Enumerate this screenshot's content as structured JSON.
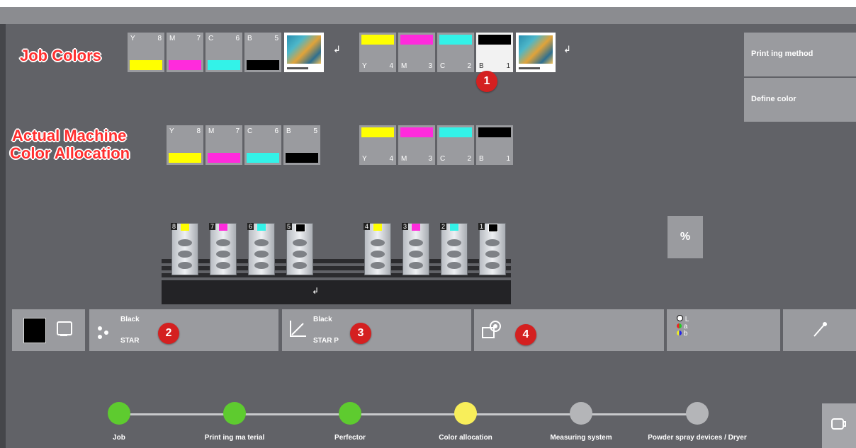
{
  "labels": {
    "job_colors": "Job Colors",
    "actual_machine_1": "Actual Machine",
    "actual_machine_2": "Color Allocation"
  },
  "job_row_left": [
    {
      "letter": "Y",
      "num": "8",
      "color": "#ffff00"
    },
    {
      "letter": "M",
      "num": "7",
      "color": "#ff2bdc"
    },
    {
      "letter": "C",
      "num": "6",
      "color": "#33f2e8"
    },
    {
      "letter": "B",
      "num": "5",
      "color": "#000000"
    }
  ],
  "job_row_right": [
    {
      "letter": "Y",
      "num": "4",
      "color": "#ffff00"
    },
    {
      "letter": "M",
      "num": "3",
      "color": "#ff2bdc"
    },
    {
      "letter": "C",
      "num": "2",
      "color": "#33f2e8"
    },
    {
      "letter": "B",
      "num": "1",
      "color": "#000000"
    }
  ],
  "machine_row_left": [
    {
      "letter": "Y",
      "num": "8",
      "color": "#ffff00"
    },
    {
      "letter": "M",
      "num": "7",
      "color": "#ff2bdc"
    },
    {
      "letter": "C",
      "num": "6",
      "color": "#33f2e8"
    },
    {
      "letter": "B",
      "num": "5",
      "color": "#000000"
    }
  ],
  "machine_row_right": [
    {
      "letter": "Y",
      "num": "4",
      "color": "#ffff00"
    },
    {
      "letter": "M",
      "num": "3",
      "color": "#ff2bdc"
    },
    {
      "letter": "C",
      "num": "2",
      "color": "#33f2e8"
    },
    {
      "letter": "B",
      "num": "1",
      "color": "#000000"
    }
  ],
  "badges": {
    "b1": "1",
    "b2": "2",
    "b3": "3",
    "b4": "4"
  },
  "side_buttons": {
    "printing_method": "Print ing method",
    "define_color": "Define color"
  },
  "toolbar": {
    "star_top": "Black",
    "star_bottom": "STAR",
    "starp_top": "Black",
    "starp_bottom": "STAR P",
    "lab_l": "L",
    "lab_a": "a",
    "lab_b": "b"
  },
  "units": [
    {
      "num": "8",
      "color": "#ffff00"
    },
    {
      "num": "7",
      "color": "#ff2bdc"
    },
    {
      "num": "6",
      "color": "#33f2e8"
    },
    {
      "num": "5",
      "color": "#000000"
    },
    {
      "num": "4",
      "color": "#ffff00"
    },
    {
      "num": "3",
      "color": "#ff2bdc"
    },
    {
      "num": "2",
      "color": "#33f2e8"
    },
    {
      "num": "1",
      "color": "#000000"
    }
  ],
  "workflow_steps": [
    {
      "label": "Job",
      "state": "done",
      "color": "#5ecb2f"
    },
    {
      "label": "Print ing ma terial",
      "state": "done",
      "color": "#5ecb2f"
    },
    {
      "label": "Perfector",
      "state": "done",
      "color": "#5ecb2f"
    },
    {
      "label": "Color allocation",
      "state": "current",
      "color": "#f8ee5a"
    },
    {
      "label": "Measuring system",
      "state": "pending",
      "color": "#b4b5b8"
    },
    {
      "label": "Powder spray devices / Dryer",
      "state": "pending",
      "color": "#b4b5b8"
    }
  ],
  "icons": {
    "return_arrow": "↲",
    "percent": "%"
  }
}
